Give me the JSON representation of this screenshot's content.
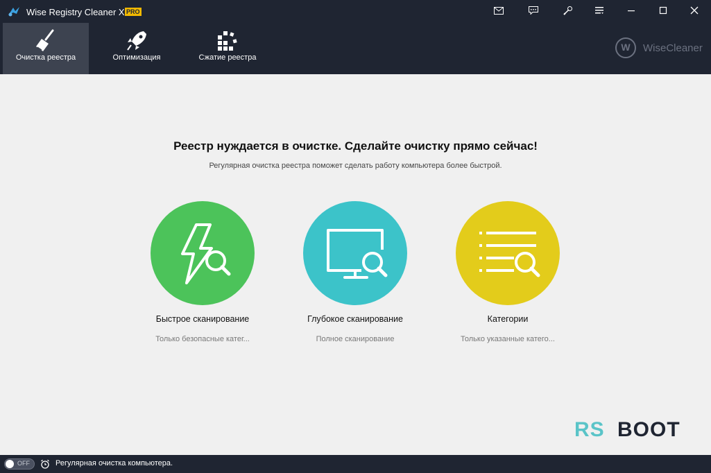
{
  "window": {
    "title": "Wise Registry Cleaner X",
    "badge": "PRO",
    "controls": [
      "mail-icon",
      "feedback-icon",
      "theme-icon",
      "menu-icon",
      "minimize-icon",
      "maximize-icon",
      "close-icon"
    ]
  },
  "tabs": [
    {
      "label": "Очистка реестра",
      "icon": "broom-icon",
      "active": true
    },
    {
      "label": "Оптимизация",
      "icon": "rocket-icon",
      "active": false
    },
    {
      "label": "Сжатие реестра",
      "icon": "blocks-icon",
      "active": false
    }
  ],
  "brand": {
    "logo_letter": "W",
    "name": "WiseCleaner"
  },
  "main": {
    "headline": "Реестр нуждается в очистке. Сделайте очистку прямо сейчас!",
    "subline": "Регулярная очистка реестра поможет сделать работу компьютера более быстрой."
  },
  "scans": [
    {
      "title": "Быстрое сканирование",
      "desc": "Только безопасные катег...",
      "color": "#4cc35a",
      "icon": "lightning-search-icon"
    },
    {
      "title": "Глубокое сканирование",
      "desc": "Полное сканирование",
      "color": "#3cc3c9",
      "icon": "monitor-search-icon"
    },
    {
      "title": "Категории",
      "desc": "Только указанные катего...",
      "color": "#e3cc1b",
      "icon": "list-search-icon"
    }
  ],
  "watermark": {
    "part1": "RS",
    "part2": "BOOT"
  },
  "status": {
    "toggle_label": "OFF",
    "text": "Регулярная очистка компьютера."
  },
  "colors": {
    "topbar": "#1f2532",
    "active_tab": "#3d4350",
    "body": "#f0f0f0",
    "badge": "#f2b900"
  }
}
